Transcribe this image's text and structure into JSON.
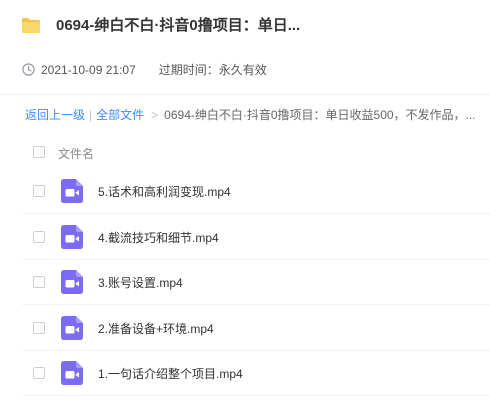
{
  "share": {
    "title": "0694-绅白不白·抖音0撸项目：单日...",
    "date": "2021-10-09 21:07",
    "expire_text": "过期时间：永久有效"
  },
  "breadcrumb": {
    "back_label": "返回上一级",
    "separator": "|",
    "all_files_label": "全部文件",
    "arrow": ">",
    "current_folder": "0694-绅白不白·抖音0撸项目：单日收益500，不发作品，..."
  },
  "list": {
    "column_name": "文件名",
    "files": [
      {
        "name": "5.话术和高利润变现.mp4",
        "icon": "video-file-icon"
      },
      {
        "name": "4.截流技巧和细节.mp4",
        "icon": "video-file-icon"
      },
      {
        "name": "3.账号设置.mp4",
        "icon": "video-file-icon"
      },
      {
        "name": "2.准备设备+环境.mp4",
        "icon": "video-file-icon"
      },
      {
        "name": "1.一句话介绍整个项目.mp4",
        "icon": "video-file-icon"
      }
    ]
  },
  "colors": {
    "folder": "#f5c34a",
    "link": "#3b8cff",
    "video_icon": "#7b6cf0"
  }
}
